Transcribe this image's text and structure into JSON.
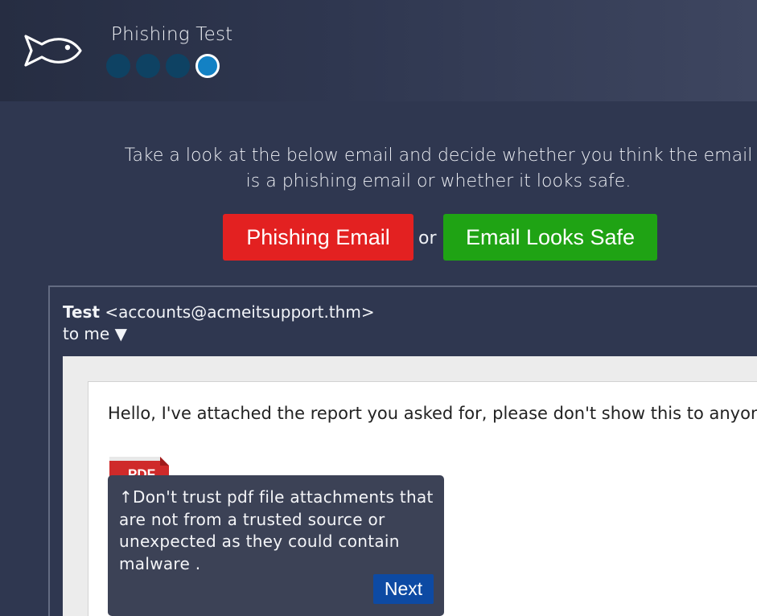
{
  "app": {
    "title": "Phishing Test"
  },
  "progress": {
    "total": 4,
    "current": 4
  },
  "instructions": "Take a look at the below email and decide whether you think the email is a phishing email or whether it looks safe.",
  "actions": {
    "phishing_label": "Phishing Email",
    "or_label": "or",
    "safe_label": "Email Looks Safe",
    "phishing_color": "#e32121",
    "safe_color": "#1fa314"
  },
  "email": {
    "sender_name": "Test",
    "sender_address": "<accounts@acmeitsupport.thm>",
    "recipient": "to me ▼",
    "message": "Hello, I've attached the report you asked for, please don't show this to anyone",
    "attachment": {
      "icon": "pdf-file-icon",
      "label": "PDF"
    }
  },
  "tooltip": {
    "text": "↑Don't trust pdf file attachments that are not from a trusted source or unexpected as they could contain malware .",
    "next_label": "Next"
  }
}
